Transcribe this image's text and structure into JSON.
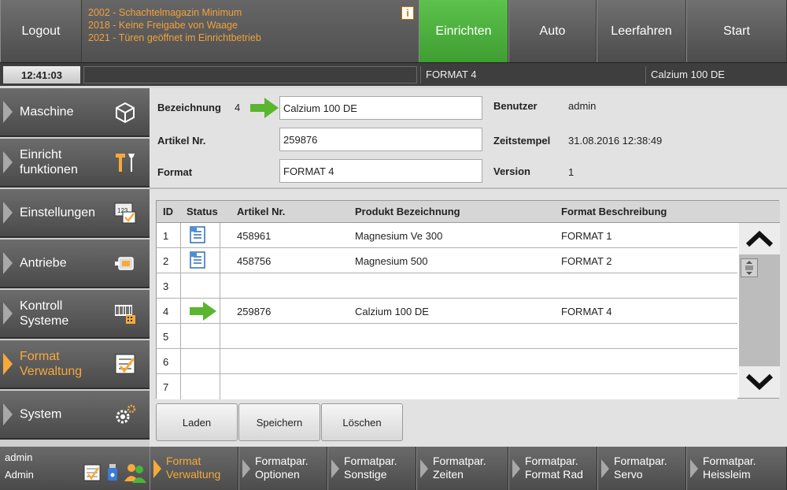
{
  "topbar": {
    "logout_label": "Logout",
    "messages": [
      "2002 - Schachtelmagazin Minimum",
      "2018 - Keine Freigabe von Waage",
      "2021 - Türen geöffnet im Einrichtbetrieb"
    ],
    "info_glyph": "i",
    "modes": [
      {
        "label": "Einrichten",
        "active": true
      },
      {
        "label": "Auto",
        "active": false
      },
      {
        "label": "Leerfahren",
        "active": false
      },
      {
        "label": "Start",
        "active": false
      }
    ]
  },
  "statusbar": {
    "time": "12:41:03",
    "format": "FORMAT 4",
    "product": "Calzium 100 DE"
  },
  "sidebar": {
    "items": [
      {
        "label_line1": "Maschine",
        "label_line2": "",
        "icon": "cube-icon",
        "active": false
      },
      {
        "label_line1": "Einricht",
        "label_line2": "funktionen",
        "icon": "tools-icon",
        "active": false
      },
      {
        "label_line1": "Einstellungen",
        "label_line2": "",
        "icon": "settings-123-icon",
        "active": false
      },
      {
        "label_line1": "Antriebe",
        "label_line2": "",
        "icon": "motor-icon",
        "active": false
      },
      {
        "label_line1": "Kontroll",
        "label_line2": "Systeme",
        "icon": "barcode-icon",
        "active": false
      },
      {
        "label_line1": "Format",
        "label_line2": "Verwaltung",
        "icon": "checklist-icon",
        "active": true
      },
      {
        "label_line1": "System",
        "label_line2": "",
        "icon": "gears-icon",
        "active": false
      }
    ]
  },
  "form": {
    "bezeichnung_label": "Bezeichnung",
    "bezeichnung_id": "4",
    "bezeichnung_value": "Calzium 100 DE",
    "artikel_label": "Artikel Nr.",
    "artikel_value": "259876",
    "format_label": "Format",
    "format_value": "FORMAT 4",
    "benutzer_label": "Benutzer",
    "benutzer_value": "admin",
    "zeitstempel_label": "Zeitstempel",
    "zeitstempel_value": "31.08.2016 12:38:49",
    "version_label": "Version",
    "version_value": "1"
  },
  "table": {
    "headers": {
      "id": "ID",
      "status": "Status",
      "artikel": "Artikel Nr.",
      "produkt": "Produkt Bezeichnung",
      "format": "Format Beschreibung"
    },
    "rows": [
      {
        "id": "1",
        "status": "document-icon",
        "artikel": "458961",
        "produkt": "Magnesium Ve 300",
        "format": "FORMAT 1"
      },
      {
        "id": "2",
        "status": "document-icon",
        "artikel": "458756",
        "produkt": "Magnesium 500",
        "format": "FORMAT 2"
      },
      {
        "id": "3",
        "status": "",
        "artikel": "",
        "produkt": "",
        "format": ""
      },
      {
        "id": "4",
        "status": "green-arrow-icon",
        "artikel": "259876",
        "produkt": "Calzium 100 DE",
        "format": "FORMAT 4"
      },
      {
        "id": "5",
        "status": "",
        "artikel": "",
        "produkt": "",
        "format": ""
      },
      {
        "id": "6",
        "status": "",
        "artikel": "",
        "produkt": "",
        "format": ""
      },
      {
        "id": "7",
        "status": "",
        "artikel": "",
        "produkt": "",
        "format": ""
      }
    ]
  },
  "actions": {
    "laden": "Laden",
    "speichern": "Speichern",
    "loeschen": "Löschen"
  },
  "user": {
    "name": "admin",
    "role": "Admin"
  },
  "bottom_tabs": [
    {
      "line1": "Format",
      "line2": "Verwaltung",
      "active": true
    },
    {
      "line1": "Formatpar.",
      "line2": "Optionen",
      "active": false
    },
    {
      "line1": "Formatpar.",
      "line2": "Sonstige",
      "active": false
    },
    {
      "line1": "Formatpar.",
      "line2": "Zeiten",
      "active": false
    },
    {
      "line1": "Formatpar.",
      "line2": "Format Rad",
      "active": false
    },
    {
      "line1": "Formatpar.",
      "line2": "Servo",
      "active": false
    },
    {
      "line1": "Formatpar.",
      "line2": "Heissleim",
      "active": false
    }
  ],
  "colors": {
    "active_green": "#4cb43c",
    "accent_orange": "#f7a93b",
    "arrow_green": "#5ab52f"
  }
}
